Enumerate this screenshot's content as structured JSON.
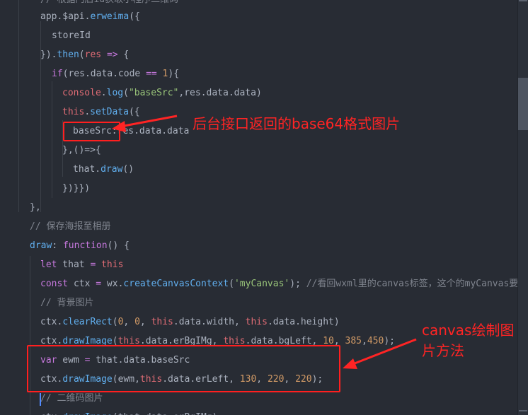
{
  "editor": {
    "lines": [
      [
        {
          "c": "cmt",
          "t": "// 根据门店id获取小程序二维码"
        }
      ],
      [
        {
          "c": "pl",
          "t": "app.$api."
        },
        {
          "c": "fn",
          "t": "erweima"
        },
        {
          "c": "pl",
          "t": "({"
        }
      ],
      [
        {
          "c": "pl",
          "t": "storeId"
        }
      ],
      [
        {
          "c": "pl",
          "t": "})."
        },
        {
          "c": "fn",
          "t": "then"
        },
        {
          "c": "pl",
          "t": "("
        },
        {
          "c": "var",
          "t": "res"
        },
        {
          "c": "pl",
          "t": " "
        },
        {
          "c": "kw",
          "t": "=>"
        },
        {
          "c": "pl",
          "t": " {"
        }
      ],
      [
        {
          "c": "kw",
          "t": "if"
        },
        {
          "c": "pl",
          "t": "(res.data.code "
        },
        {
          "c": "kw",
          "t": "=="
        },
        {
          "c": "pl",
          "t": " "
        },
        {
          "c": "num",
          "t": "1"
        },
        {
          "c": "pl",
          "t": "){"
        }
      ],
      [
        {
          "c": "var",
          "t": "console"
        },
        {
          "c": "pl",
          "t": "."
        },
        {
          "c": "fn",
          "t": "log"
        },
        {
          "c": "pl",
          "t": "("
        },
        {
          "c": "str",
          "t": "\"baseSrc\""
        },
        {
          "c": "pl",
          "t": ",res.data.data)"
        }
      ],
      [
        {
          "c": "var",
          "t": "this"
        },
        {
          "c": "pl",
          "t": "."
        },
        {
          "c": "fn",
          "t": "setData"
        },
        {
          "c": "pl",
          "t": "({"
        }
      ],
      [
        {
          "c": "pl",
          "t": "baseSrc:res.data.data"
        }
      ],
      [
        {
          "c": "pl",
          "t": "},()=>{"
        }
      ],
      [
        {
          "c": "pl",
          "t": "that."
        },
        {
          "c": "fn",
          "t": "draw"
        },
        {
          "c": "pl",
          "t": "()"
        }
      ],
      [
        {
          "c": "pl",
          "t": "})}})"
        }
      ],
      [
        {
          "c": "pl",
          "t": "},"
        }
      ],
      [
        {
          "c": "cmt",
          "t": "// 保存海报至相册"
        }
      ],
      [
        {
          "c": "fn",
          "t": "draw"
        },
        {
          "c": "pl",
          "t": ": "
        },
        {
          "c": "kw",
          "t": "function"
        },
        {
          "c": "pl",
          "t": "() {"
        }
      ],
      [
        {
          "c": "kw",
          "t": "let"
        },
        {
          "c": "pl",
          "t": " that "
        },
        {
          "c": "kw",
          "t": "="
        },
        {
          "c": "pl",
          "t": " "
        },
        {
          "c": "var",
          "t": "this"
        }
      ],
      [
        {
          "c": "kw",
          "t": "const"
        },
        {
          "c": "pl",
          "t": " ctx "
        },
        {
          "c": "kw",
          "t": "="
        },
        {
          "c": "pl",
          "t": " wx."
        },
        {
          "c": "fn",
          "t": "createCanvasContext"
        },
        {
          "c": "pl",
          "t": "("
        },
        {
          "c": "str",
          "t": "'myCanvas'"
        },
        {
          "c": "pl",
          "t": "); "
        },
        {
          "c": "cmt",
          "t": "//看回wxml里的canvas标签，这个的myCanvas要和标签里的canvas-id一致"
        }
      ],
      [
        {
          "c": "cmt",
          "t": "// 背景图片"
        }
      ],
      [
        {
          "c": "pl",
          "t": "ctx."
        },
        {
          "c": "fn",
          "t": "clearRect"
        },
        {
          "c": "pl",
          "t": "("
        },
        {
          "c": "num",
          "t": "0"
        },
        {
          "c": "pl",
          "t": ", "
        },
        {
          "c": "num",
          "t": "0"
        },
        {
          "c": "pl",
          "t": ", "
        },
        {
          "c": "var",
          "t": "this"
        },
        {
          "c": "pl",
          "t": ".data.width, "
        },
        {
          "c": "var",
          "t": "this"
        },
        {
          "c": "pl",
          "t": ".data.height)"
        }
      ],
      [
        {
          "c": "pl",
          "t": "ctx."
        },
        {
          "c": "fn",
          "t": "drawImage"
        },
        {
          "c": "pl",
          "t": "("
        },
        {
          "c": "var",
          "t": "this"
        },
        {
          "c": "pl",
          "t": ".data.erBgIMg, "
        },
        {
          "c": "var",
          "t": "this"
        },
        {
          "c": "pl",
          "t": ".data.bgLeft, "
        },
        {
          "c": "num",
          "t": "10"
        },
        {
          "c": "pl",
          "t": ", "
        },
        {
          "c": "num",
          "t": "385"
        },
        {
          "c": "pl",
          "t": ","
        },
        {
          "c": "num",
          "t": "450"
        },
        {
          "c": "pl",
          "t": ");"
        }
      ],
      [
        {
          "c": "kw",
          "t": "var"
        },
        {
          "c": "pl",
          "t": " ewm "
        },
        {
          "c": "kw",
          "t": "="
        },
        {
          "c": "pl",
          "t": " that.data.baseSrc"
        }
      ],
      [
        {
          "c": "pl",
          "t": "ctx."
        },
        {
          "c": "fn",
          "t": "drawImage"
        },
        {
          "c": "pl",
          "t": "(ewm,"
        },
        {
          "c": "var",
          "t": "this"
        },
        {
          "c": "pl",
          "t": ".data.erLeft, "
        },
        {
          "c": "num",
          "t": "130"
        },
        {
          "c": "pl",
          "t": ", "
        },
        {
          "c": "num",
          "t": "220"
        },
        {
          "c": "pl",
          "t": ", "
        },
        {
          "c": "num",
          "t": "220"
        },
        {
          "c": "pl",
          "t": ");"
        }
      ],
      [
        {
          "c": "cmt",
          "t": "// 二维码图片"
        }
      ],
      [
        {
          "c": "pl",
          "t": "ctx."
        },
        {
          "c": "fn",
          "t": "drawImage"
        },
        {
          "c": "pl",
          "t": "(that.data.erBgIMg);"
        }
      ]
    ]
  },
  "annotations": {
    "label_1": "后台接口返回的base64格式图片",
    "label_2_line1": "canvas绘制图",
    "label_2_line2": "片方法",
    "color": "#ff2424"
  },
  "theme": {
    "background": "#282c34",
    "keyword": "#c678dd",
    "function": "#61afef",
    "string": "#98c379",
    "number": "#d19a66",
    "variable": "#e06c75",
    "comment": "#7f848e"
  }
}
